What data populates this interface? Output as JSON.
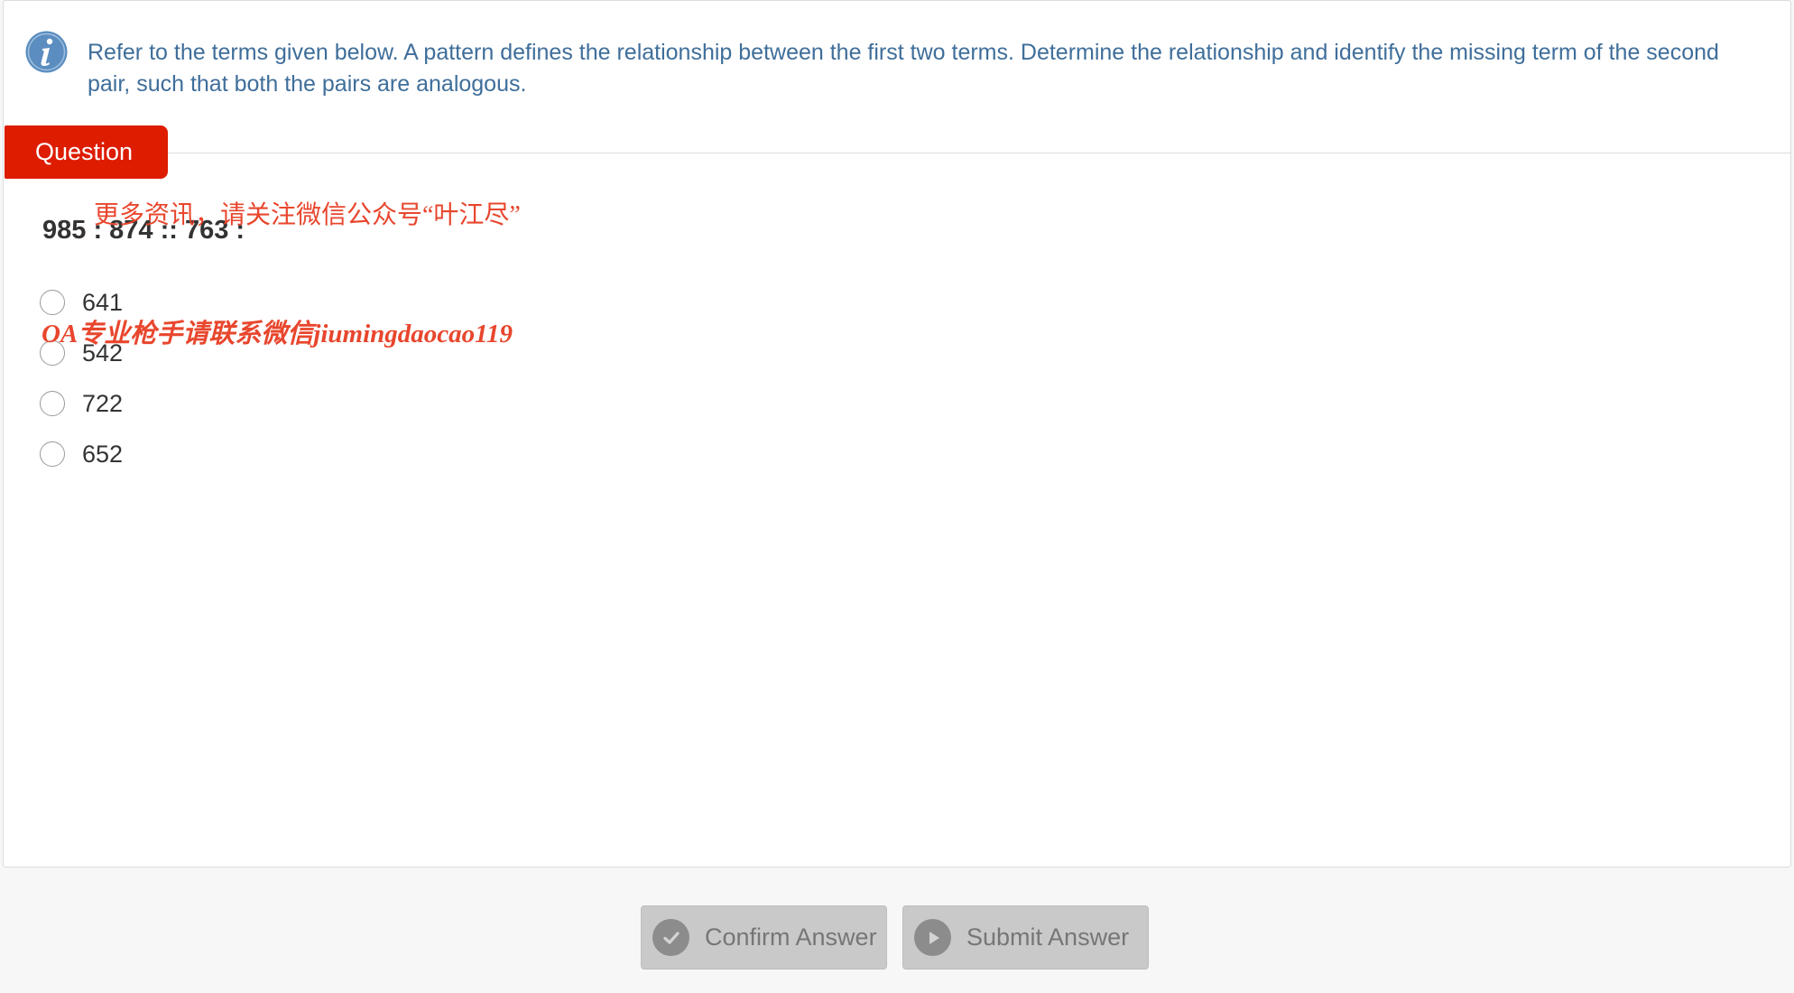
{
  "instructions": {
    "text": "Refer to the terms given below. A pattern defines the relationship between the first two terms. Determine the relationship and identify the missing term of the second pair, such that both the pairs are analogous."
  },
  "question_tab": {
    "label": "Question"
  },
  "question": {
    "text": "985 : 874 :: 763 :"
  },
  "options": [
    {
      "label": "641"
    },
    {
      "label": "542"
    },
    {
      "label": "722"
    },
    {
      "label": "652"
    }
  ],
  "watermarks": [
    "更多资讯，请关注微信公众号“叶江尽”",
    "OA专业枪手请联系微信jiumingdaocao119"
  ],
  "buttons": {
    "confirm_label": "Confirm Answer",
    "submit_label": "Submit Answer"
  },
  "colors": {
    "accent_red": "#dd1c00",
    "instruction_blue": "#3f6e9a",
    "info_icon_blue": "#5b8dc0",
    "watermark_red": "#e8462d",
    "button_disabled": "#c9c9c9"
  },
  "icons": [
    "info-icon",
    "check-circle-icon",
    "play-circle-icon"
  ]
}
